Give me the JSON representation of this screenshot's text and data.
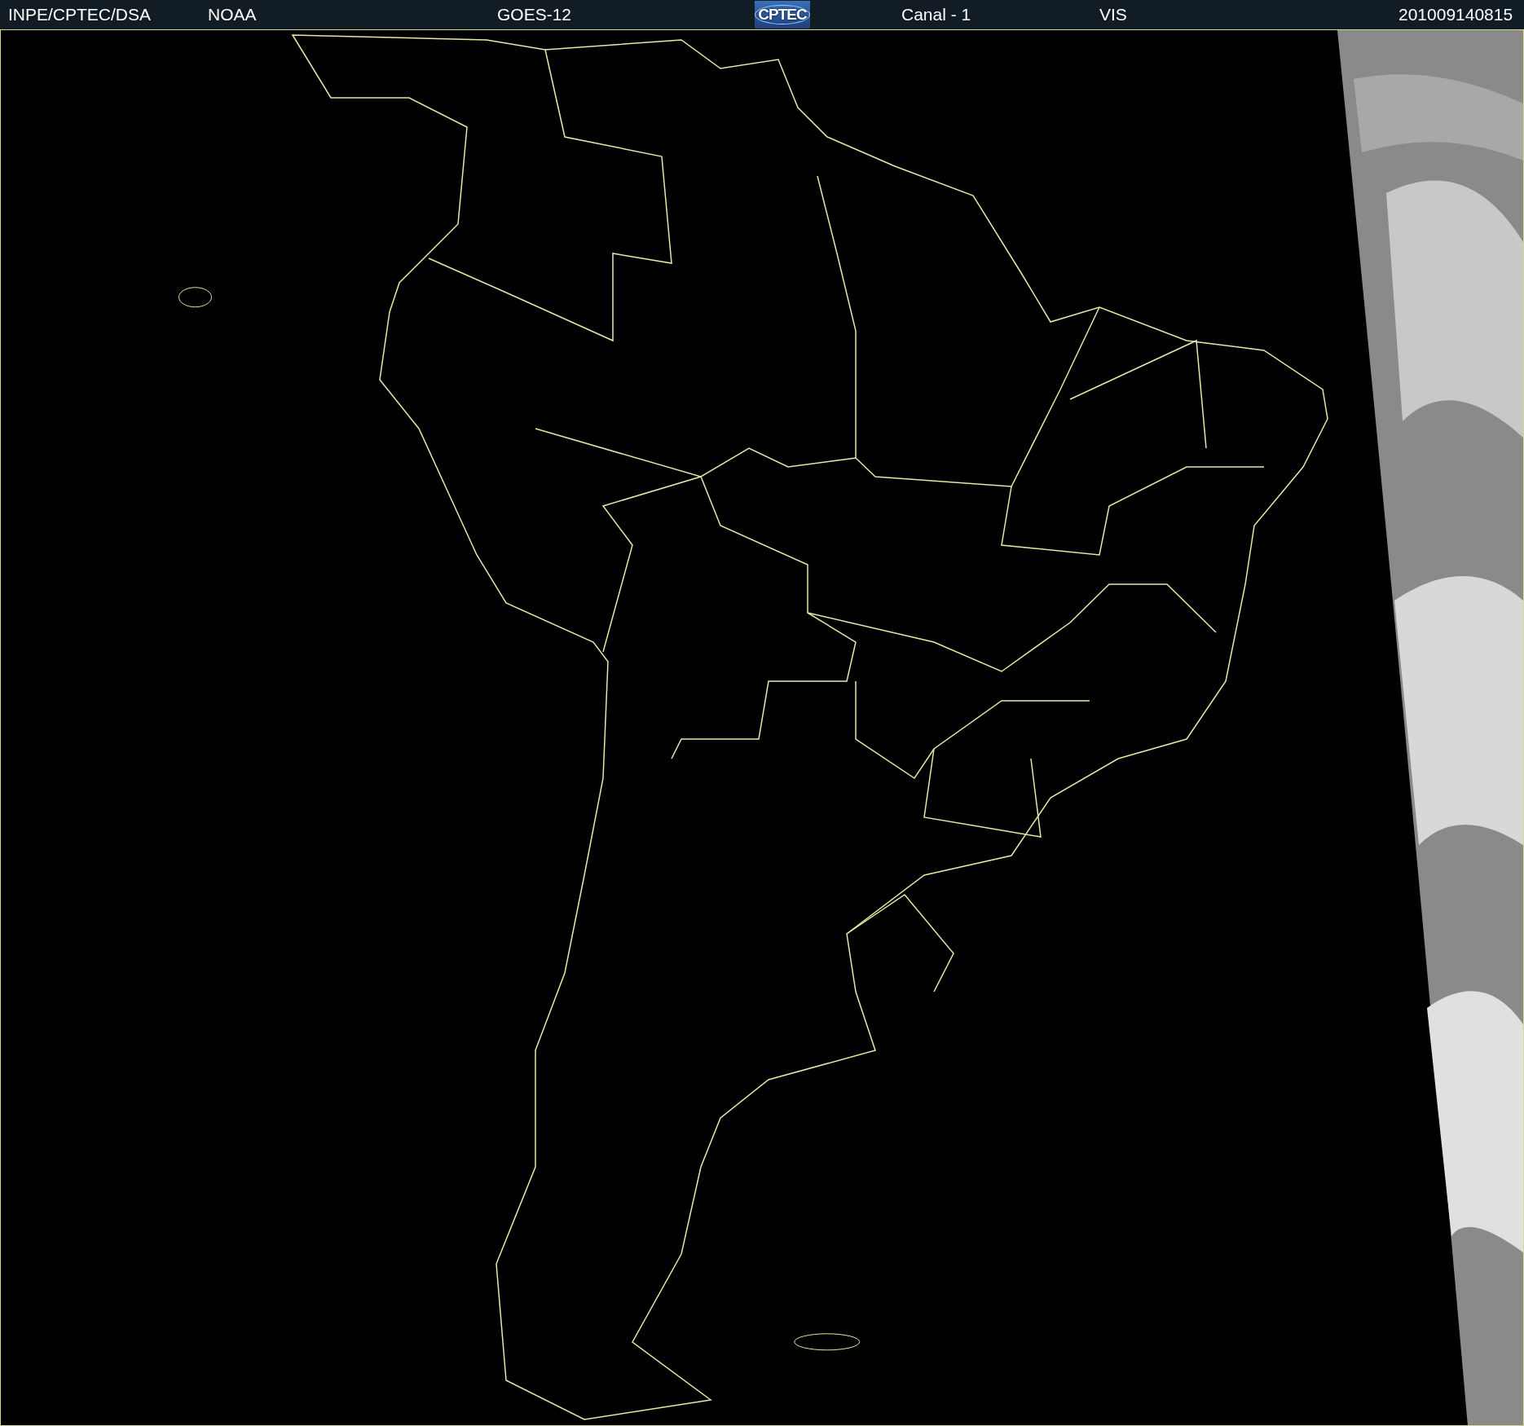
{
  "header": {
    "items": [
      {
        "kind": "text",
        "text": "INPE/CPTEC/DSA"
      },
      {
        "kind": "text",
        "text": "NOAA"
      },
      {
        "kind": "text",
        "text": "GOES-12"
      },
      {
        "kind": "logo",
        "text": "CPTEC"
      },
      {
        "kind": "text",
        "text": "Canal - 1"
      },
      {
        "kind": "text",
        "text": "VIS"
      },
      {
        "kind": "text",
        "text": "201009140815"
      }
    ]
  }
}
